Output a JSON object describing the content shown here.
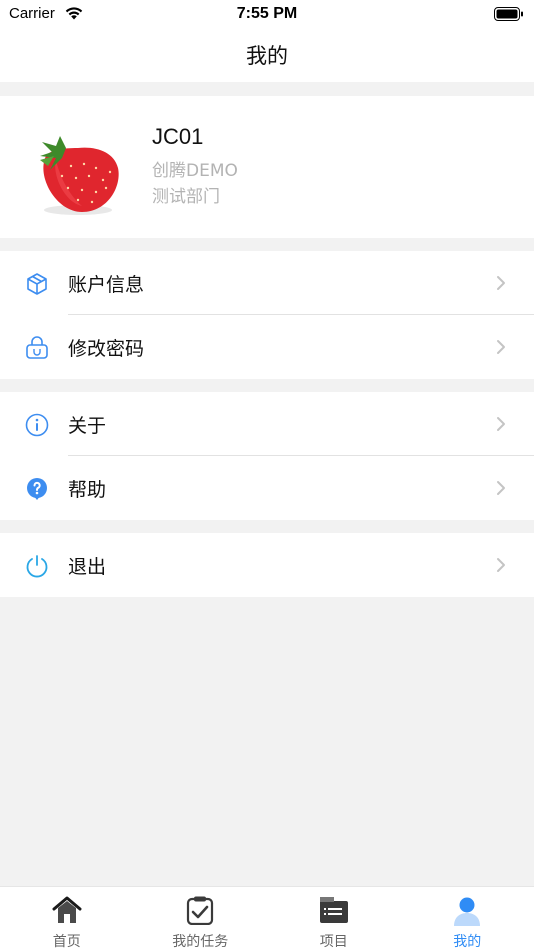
{
  "status_bar": {
    "carrier": "Carrier",
    "time": "7:55 PM"
  },
  "nav": {
    "title": "我的"
  },
  "profile": {
    "name": "JC01",
    "company": "创腾DEMO",
    "department": "测试部门"
  },
  "menu": {
    "account_info": "账户信息",
    "change_password": "修改密码",
    "about": "关于",
    "help": "帮助",
    "logout": "退出"
  },
  "tabs": [
    {
      "label": "首页",
      "icon": "home-icon"
    },
    {
      "label": "我的任务",
      "icon": "task-clipboard-icon"
    },
    {
      "label": "项目",
      "icon": "project-folder-icon"
    },
    {
      "label": "我的",
      "icon": "person-icon",
      "active": true
    }
  ],
  "colors": {
    "accent": "#2f8cf5",
    "muted_text": "#b3b3b3",
    "background": "#f2f2f2"
  }
}
